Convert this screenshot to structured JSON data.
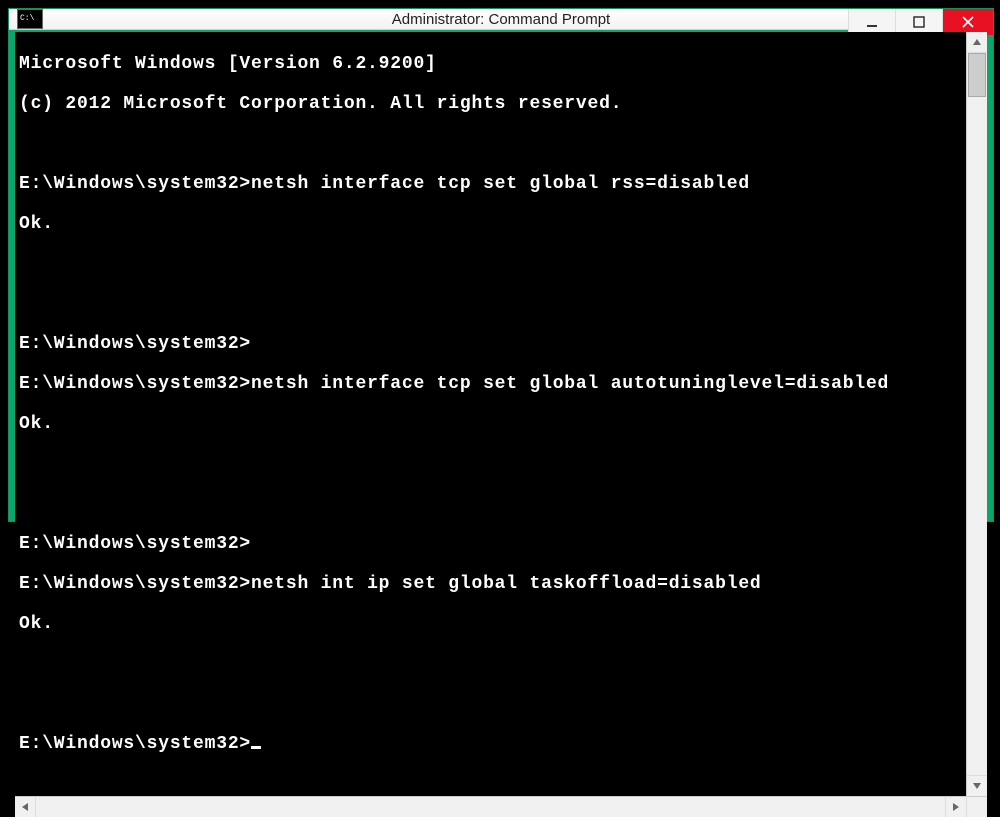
{
  "window": {
    "title": "Administrator: Command Prompt"
  },
  "terminal": {
    "header1": "Microsoft Windows [Version 6.2.9200]",
    "header2": "(c) 2012 Microsoft Corporation. All rights reserved.",
    "prompt": "E:\\Windows\\system32>",
    "cmd1": "netsh interface tcp set global rss=disabled",
    "ok": "Ok.",
    "cmd2": "netsh interface tcp set global autotuninglevel=disabled",
    "cmd3": "netsh int ip set global taskoffload=disabled"
  }
}
